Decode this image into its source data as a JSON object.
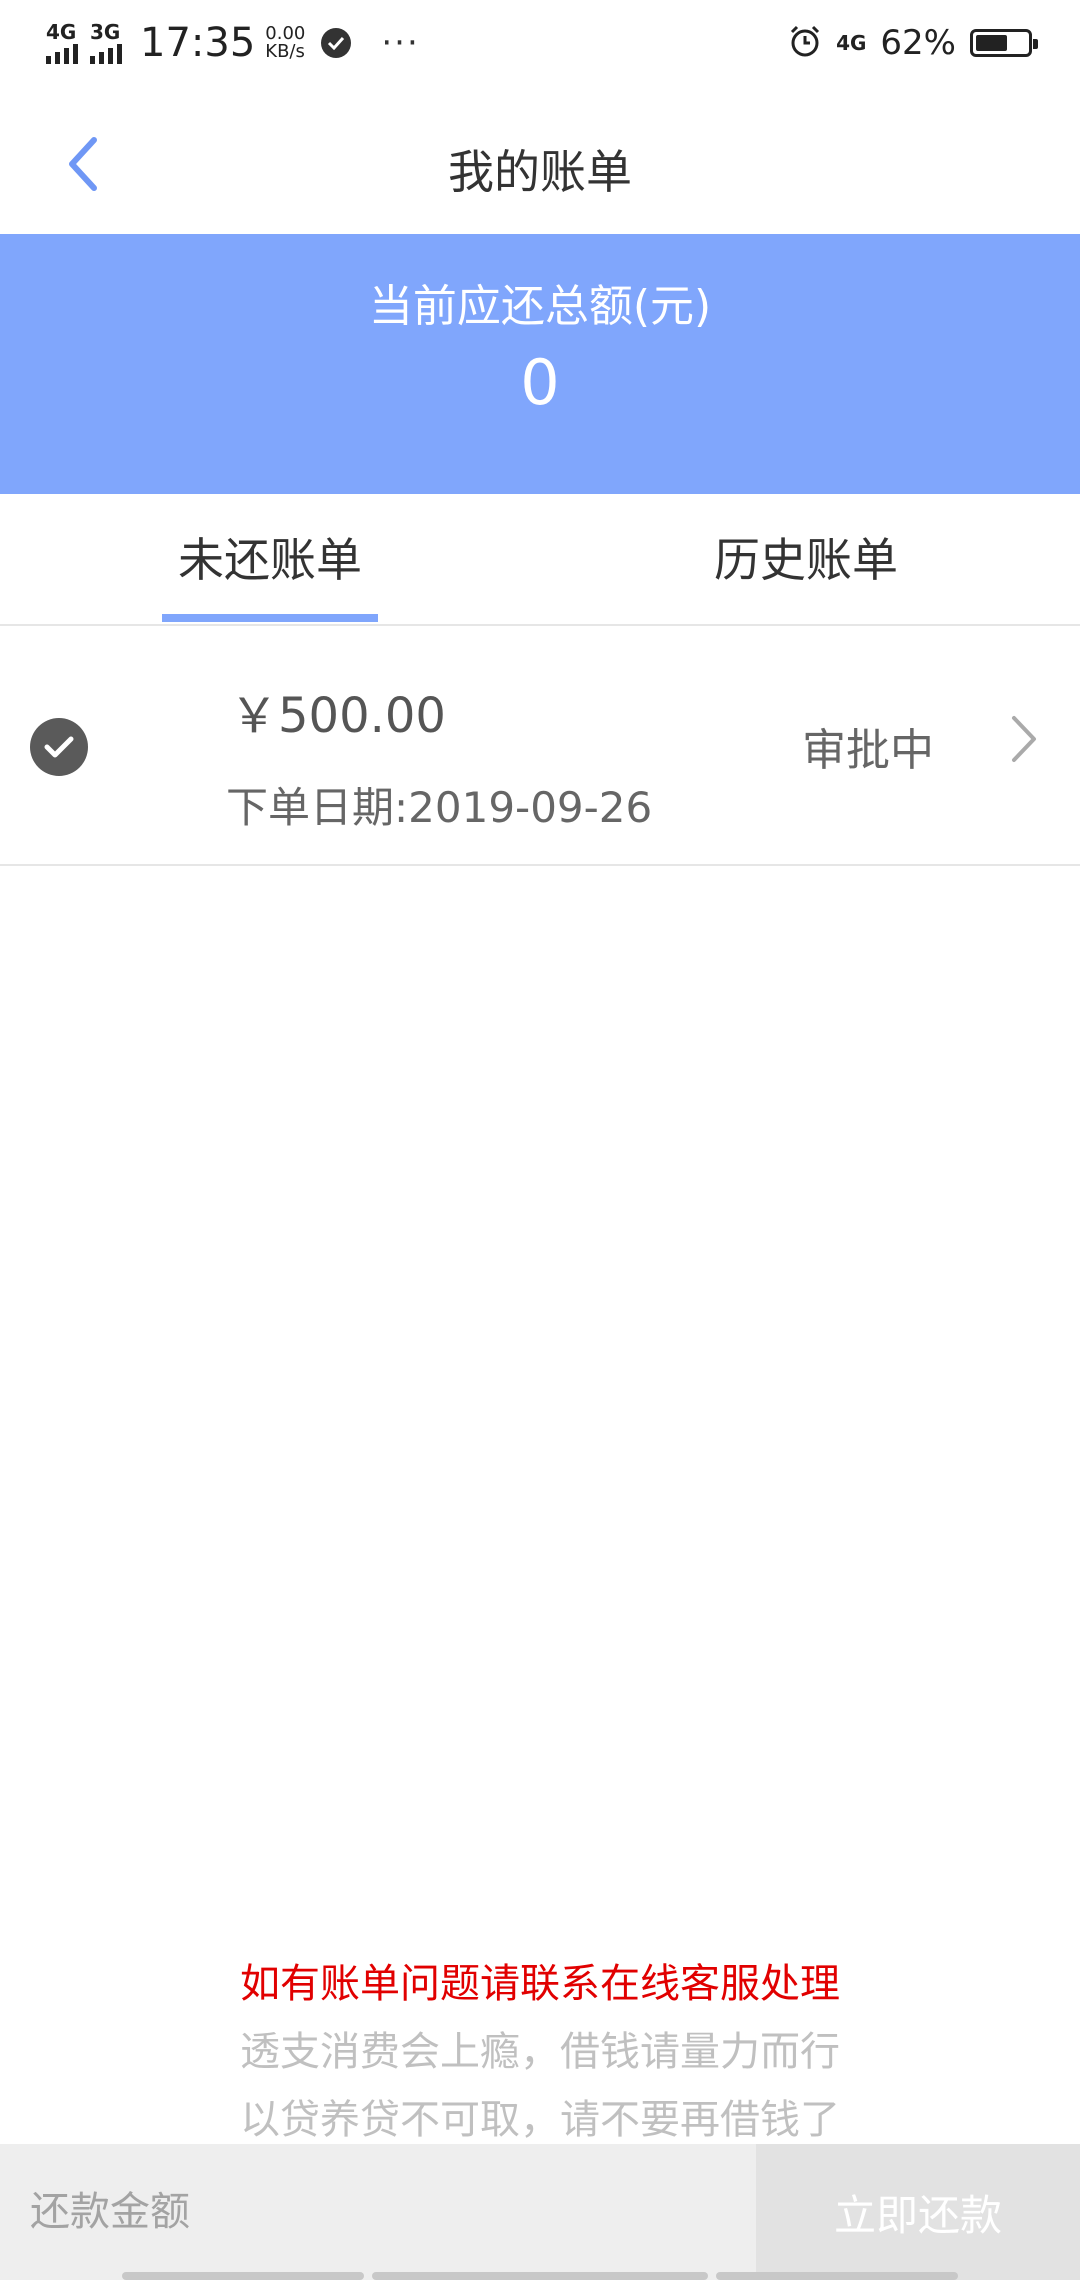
{
  "status_bar": {
    "signal1": "4G",
    "signal2": "3G",
    "time": "17:35",
    "speed_value": "0.00",
    "speed_unit": "KB/s",
    "network_right": "4G",
    "battery_percent": "62%",
    "battery_level": 0.62
  },
  "nav": {
    "title": "我的账单"
  },
  "header": {
    "label": "当前应还总额(元)",
    "amount": "0"
  },
  "tabs": [
    {
      "label": "未还账单",
      "active": true
    },
    {
      "label": "历史账单",
      "active": false
    }
  ],
  "bills": [
    {
      "amount": "￥500.00",
      "date": "下单日期:2019-09-26",
      "status": "审批中"
    }
  ],
  "notice": {
    "line1": "如有账单问题请联系在线客服处理",
    "line2": "透支消费会上瘾，借钱请量力而行",
    "line3": "以贷养贷不可取，请不要再借钱了"
  },
  "bottom": {
    "input_placeholder": "还款金额",
    "pay_button": "立即还款"
  },
  "colors": {
    "accent": "#80a6fc",
    "notice_red": "#e10000"
  }
}
